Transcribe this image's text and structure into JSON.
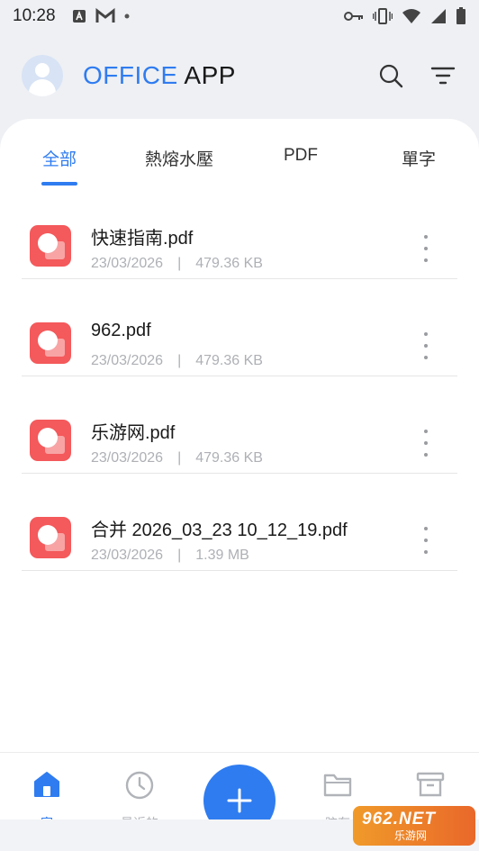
{
  "status_bar": {
    "time": "10:28",
    "left_icons": [
      "a-notification-icon",
      "gmail-icon",
      "dot-icon"
    ],
    "right_icons": [
      "vpn-key-icon",
      "vibrate-icon",
      "wifi-icon",
      "signal-icon",
      "battery-icon"
    ]
  },
  "header": {
    "brand_accent": "OFFICE",
    "brand_rest": " APP",
    "actions": [
      "search-icon",
      "filter-icon"
    ]
  },
  "tabs": [
    {
      "label": "全部",
      "active": true
    },
    {
      "label": "熱熔水壓",
      "active": false
    },
    {
      "label": "PDF",
      "active": false
    },
    {
      "label": "單字",
      "active": false
    }
  ],
  "files": [
    {
      "name": "快速指南.pdf",
      "date": "23/03/2026",
      "separator": "|",
      "size": "479.36 KB"
    },
    {
      "name": "962.pdf",
      "date": "23/03/2026",
      "separator": "|",
      "size": "479.36 KB"
    },
    {
      "name": "乐游网.pdf",
      "date": "23/03/2026",
      "separator": "|",
      "size": "479.36 KB"
    },
    {
      "name": "合并 2026_03_23 10_12_19.pdf",
      "date": "23/03/2026",
      "separator": "|",
      "size": "1.39 MB"
    }
  ],
  "bottom_nav": [
    {
      "label": "家",
      "icon": "home-icon",
      "active": true
    },
    {
      "label": "最近的",
      "icon": "clock-icon",
      "active": false
    },
    {
      "label": "",
      "icon": "plus-icon",
      "active": false
    },
    {
      "label": "脑存",
      "icon": "folder-icon",
      "active": false
    },
    {
      "label": "",
      "icon": "archive-icon",
      "active": false
    }
  ],
  "watermark": {
    "top": "962.NET",
    "bottom": "乐游网"
  },
  "colors": {
    "accent": "#2f7cf0",
    "file_icon": "#f4595b",
    "background": "#eef0f4"
  }
}
